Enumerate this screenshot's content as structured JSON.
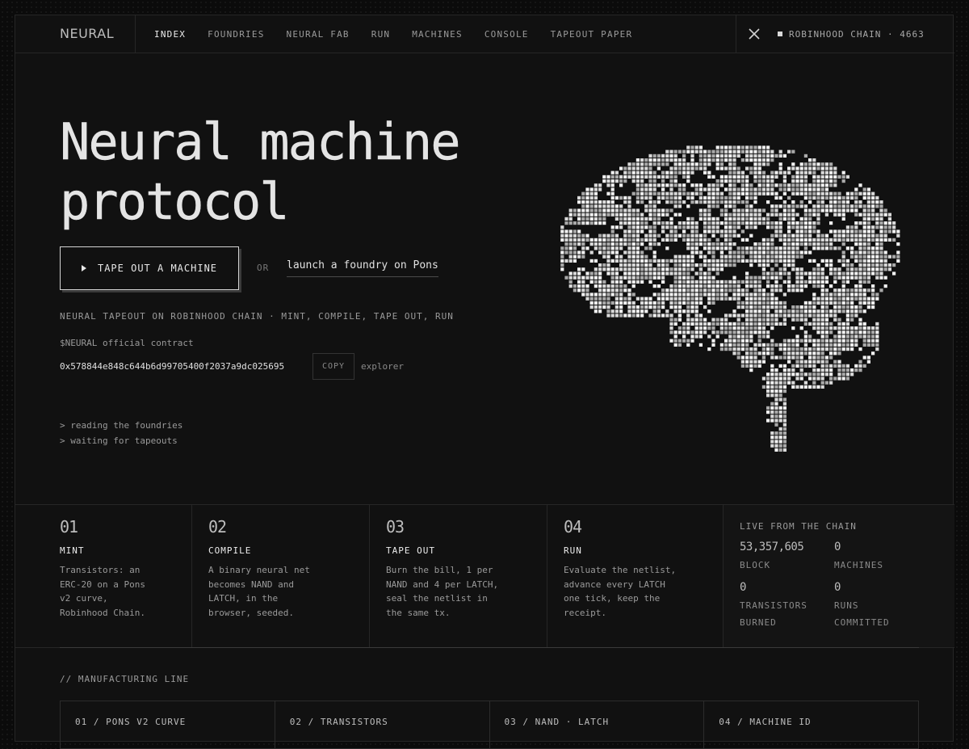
{
  "brand": "NEURAL",
  "nav": {
    "links": [
      "INDEX",
      "FOUNDRIES",
      "NEURAL FAB",
      "RUN",
      "MACHINES",
      "CONSOLE",
      "TAPEOUT PAPER"
    ],
    "active": "INDEX",
    "chain": "ROBINHOOD CHAIN · 4663",
    "x_icon": "x-logo-icon"
  },
  "hero": {
    "title_line1": "Neural machine",
    "title_line2": "protocol",
    "cta_label": "TAPE OUT A MACHINE",
    "or_label": "OR",
    "foundry_link": "launch a foundry on Pons",
    "tagline": "NEURAL TAPEOUT ON ROBINHOOD CHAIN · MINT, COMPILE, TAPE OUT, RUN",
    "contract_label": "$NEURAL official contract",
    "contract_address": "0x578844e848c644b6d99705400f2037a9dc025695",
    "copy_label": "COPY",
    "explorer_label": "explorer",
    "log": [
      "> reading the foundries",
      "> waiting for tapeouts"
    ]
  },
  "steps": [
    {
      "num": "01",
      "name": "MINT",
      "desc": [
        "Transistors: an",
        "ERC-20 on a Pons",
        "v2 curve,",
        "Robinhood Chain."
      ]
    },
    {
      "num": "02",
      "name": "COMPILE",
      "desc": [
        "A binary neural net",
        "becomes NAND and",
        "LATCH, in the",
        "browser, seeded."
      ]
    },
    {
      "num": "03",
      "name": "TAPE OUT",
      "desc": [
        "Burn the bill, 1 per",
        "NAND and 4 per LATCH,",
        "seal the netlist in",
        "the same tx."
      ]
    },
    {
      "num": "04",
      "name": "RUN",
      "desc": [
        "Evaluate the netlist,",
        "advance every LATCH",
        "one tick, keep the",
        "receipt."
      ]
    }
  ],
  "live": {
    "heading": "LIVE FROM THE CHAIN",
    "block_value": "53,357,605",
    "block_label": "BLOCK",
    "machines_value": "0",
    "machines_label": "MACHINES",
    "transistors_value": "0",
    "transistors_label_1": "TRANSISTORS",
    "transistors_label_2": "BURNED",
    "runs_value": "0",
    "runs_label_1": "RUNS",
    "runs_label_2": "COMMITTED"
  },
  "manufacturing": {
    "heading": "// MANUFACTURING LINE",
    "cells": [
      "01 / PONS V2 CURVE",
      "02 / TRANSISTORS",
      "03 / NAND · LATCH",
      "04 / MACHINE ID"
    ]
  },
  "colors": {
    "background": "#111111",
    "text": "#e4e4e4",
    "muted": "#9a9a9a",
    "border": "#262626"
  }
}
